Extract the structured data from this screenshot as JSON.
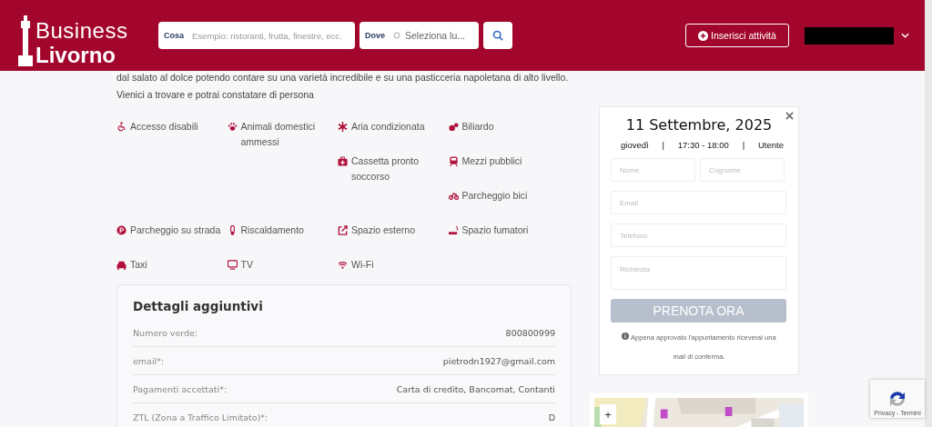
{
  "header": {
    "logo": {
      "line_1": "Business",
      "line_2": "Livorno"
    },
    "search": {
      "what_label": "Cosa",
      "what_placeholder": "Esempio: ristoranti, frutta, finestre, ecc.",
      "where_label": "Dove",
      "where_placeholder": "Seleziona lu..."
    },
    "add_button": "Inserisci attività"
  },
  "description": [
    "dal salato al dolce potendo contare su una varietà incredibile e su una pasticceria napoletana di alto livello.",
    "Vienici a trovare e potrai constatare di persona"
  ],
  "amenities": [
    "Accesso disabili",
    "Animali domestici ammessi",
    "Aria condizionata",
    "Biliardo",
    "Cassetta pronto soccorso",
    "Mezzi pubblici",
    "Parcheggio bici",
    "Parcheggio su strada",
    "Riscaldamento",
    "Spazio esterno",
    "Spazio fumatori",
    "Taxi",
    "TV",
    "Wi-Fi"
  ],
  "details": {
    "title": "Dettagli aggiuntivi",
    "rows": [
      {
        "label": "Numero verde:",
        "value": "800800999"
      },
      {
        "label": "email*:",
        "value": "pietrodn1927@gmail.com"
      },
      {
        "label": "Pagamenti accettati*:",
        "value": "Carta di credito, Bancomat, Contanti"
      },
      {
        "label": "ZTL (Zona a Traffico Limitato)*:",
        "value": "D"
      }
    ]
  },
  "booking": {
    "date": "11 Settembre, 2025",
    "day": "giovedì",
    "separator_1": "|",
    "time": "17:30 - 18:00",
    "separator_2": "|",
    "user": "Utente",
    "fields": [
      {
        "placeholder": "Nome",
        "kind": "half"
      },
      {
        "placeholder": "Cognome",
        "kind": "half"
      },
      {
        "placeholder": "Email",
        "kind": "full"
      },
      {
        "placeholder": "Telefono",
        "kind": "full"
      },
      {
        "placeholder": "Richiesta",
        "kind": "area"
      }
    ],
    "submit": {
      "label": "PRENOTA ORA",
      "disabled": true
    },
    "note": "Appena approvato l'appuntamento riceverai una mail di conferma."
  },
  "map": {
    "kind": "picture",
    "zoom_in": "+"
  },
  "recaptcha": {
    "links": "Privacy - Termini"
  }
}
